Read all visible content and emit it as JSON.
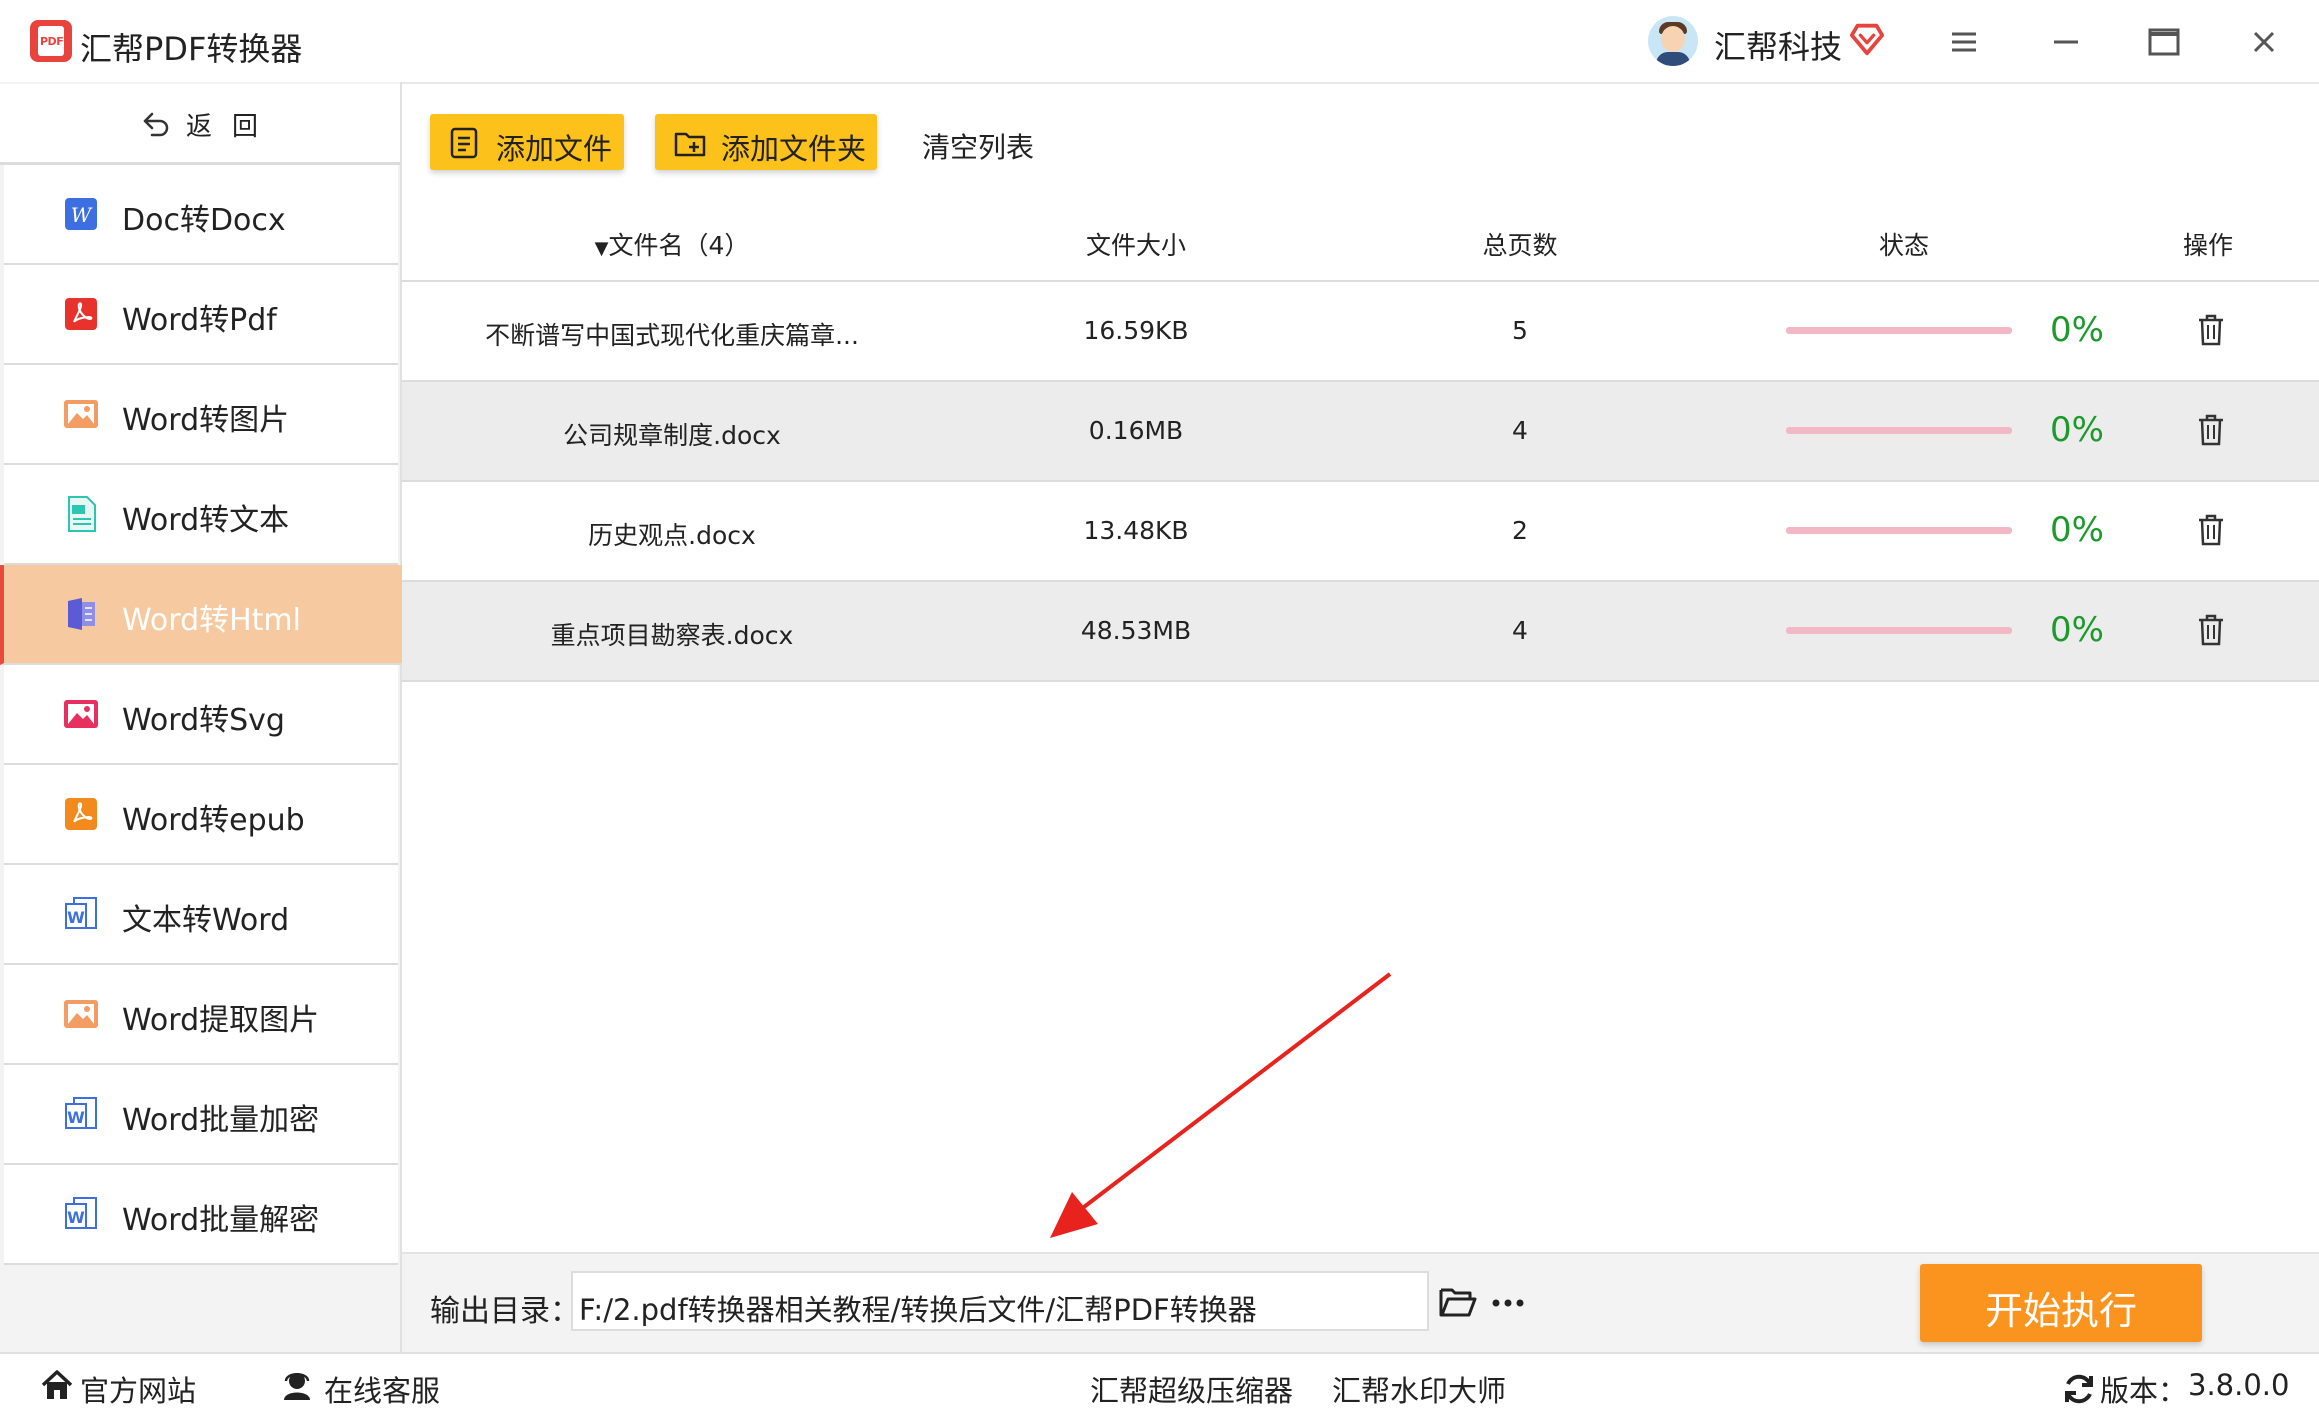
{
  "app": {
    "title": "汇帮PDF转换器",
    "logo_text": "PDF",
    "user_name": "汇帮科技"
  },
  "colors": {
    "accent_yellow": "#fcc11b",
    "start_orange": "#fb941f",
    "active_item": "#f7c9a0",
    "progress_track": "#f2b8c6",
    "percent_green": "#1c9a2c"
  },
  "sidebar": {
    "back_label": "返回",
    "items": [
      {
        "label": "Doc转Docx",
        "icon": "word-w-icon",
        "active": false
      },
      {
        "label": "Word转Pdf",
        "icon": "pdf-icon",
        "active": false
      },
      {
        "label": "Word转图片",
        "icon": "image-icon",
        "active": false
      },
      {
        "label": "Word转文本",
        "icon": "text-doc-icon",
        "active": false
      },
      {
        "label": "Word转Html",
        "icon": "html-doc-icon",
        "active": true
      },
      {
        "label": "Word转Svg",
        "icon": "svg-image-icon",
        "active": false
      },
      {
        "label": "Word转epub",
        "icon": "epub-icon",
        "active": false
      },
      {
        "label": "文本转Word",
        "icon": "word-doc-icon",
        "active": false
      },
      {
        "label": "Word提取图片",
        "icon": "extract-image-icon",
        "active": false
      },
      {
        "label": "Word批量加密",
        "icon": "word-doc-icon",
        "active": false
      },
      {
        "label": "Word批量解密",
        "icon": "word-doc-icon",
        "active": false
      }
    ]
  },
  "toolbar": {
    "add_file_label": "添加文件",
    "add_folder_label": "添加文件夹",
    "clear_list_label": "清空列表"
  },
  "table": {
    "headers": {
      "name": "文件名（4）",
      "size": "文件大小",
      "pages": "总页数",
      "status": "状态",
      "action": "操作"
    },
    "rows": [
      {
        "name": "不断谱写中国式现代化重庆篇章...",
        "size": "16.59KB",
        "pages": "5",
        "progress": 0,
        "percent": "0%"
      },
      {
        "name": "公司规章制度.docx",
        "size": "0.16MB",
        "pages": "4",
        "progress": 0,
        "percent": "0%"
      },
      {
        "name": "历史观点.docx",
        "size": "13.48KB",
        "pages": "2",
        "progress": 0,
        "percent": "0%"
      },
      {
        "name": "重点项目勘察表.docx",
        "size": "48.53MB",
        "pages": "4",
        "progress": 0,
        "percent": "0%"
      }
    ]
  },
  "output": {
    "label": "输出目录：",
    "path": "F:/2.pdf转换器相关教程/转换后文件/汇帮PDF转换器",
    "start_label": "开始执行"
  },
  "statusbar": {
    "website": "官方网站",
    "support": "在线客服",
    "compressor": "汇帮超级压缩器",
    "watermark": "汇帮水印大师",
    "version_label": "版本：",
    "version": "3.8.0.0"
  }
}
